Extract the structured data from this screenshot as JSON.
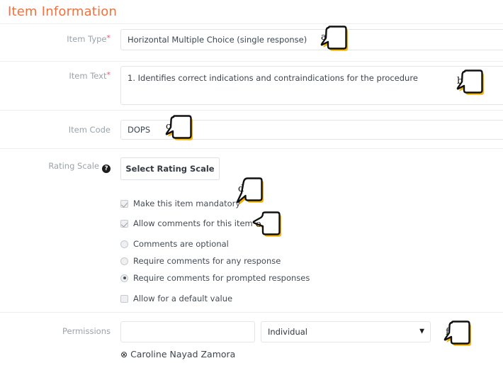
{
  "page": {
    "title": "Item Information"
  },
  "form": {
    "item_type": {
      "label": "Item Type",
      "required_marker": "*",
      "value": "Horizontal Multiple Choice (single response)"
    },
    "item_text": {
      "label": "Item Text",
      "required_marker": "*",
      "value": "1. Identifies correct indications and contraindications for the procedure"
    },
    "item_code": {
      "label": "Item Code",
      "value": "DOPS"
    },
    "rating_scale": {
      "label": "Rating Scale",
      "help_icon": "question-mark-icon",
      "help_glyph": "?",
      "button_label": "Select Rating Scale"
    },
    "options": [
      {
        "type": "checkbox",
        "state": "checked",
        "label": "Make this item mandatory"
      },
      {
        "type": "checkbox",
        "state": "checked",
        "label": "Allow comments for this item"
      },
      {
        "type": "radio",
        "state": "unselected",
        "label": "Comments are optional"
      },
      {
        "type": "radio",
        "state": "unselected",
        "label": "Require comments for any response"
      },
      {
        "type": "radio",
        "state": "selected",
        "label": "Require comments for prompted responses"
      },
      {
        "type": "checkbox",
        "state": "unchecked",
        "label": "Allow for a default value"
      }
    ],
    "permissions": {
      "label": "Permissions",
      "search_value": "",
      "search_placeholder": "",
      "scope_selected": "Individual",
      "scope_caret_icon": "caret-down-icon",
      "scope_caret_glyph": "▼",
      "chip": {
        "remove_icon": "remove-circle-icon",
        "remove_glyph": "⊗",
        "name": "Caroline Nayad Zamora"
      }
    }
  },
  "callouts": [
    {
      "id": "a",
      "letter": "a"
    },
    {
      "id": "b",
      "letter": "b"
    },
    {
      "id": "c",
      "letter": "c"
    },
    {
      "id": "d",
      "letter": "d"
    },
    {
      "id": "e",
      "letter": "e"
    },
    {
      "id": "f",
      "letter": "f"
    }
  ],
  "colors": {
    "title": "#f2703a",
    "required_star": "#f0506e",
    "label": "#9aa3ab",
    "callout_shadow": "#f5b400",
    "callout_outline": "#111111",
    "separator": "#eceef0",
    "input_border": "#e3e5e8"
  }
}
